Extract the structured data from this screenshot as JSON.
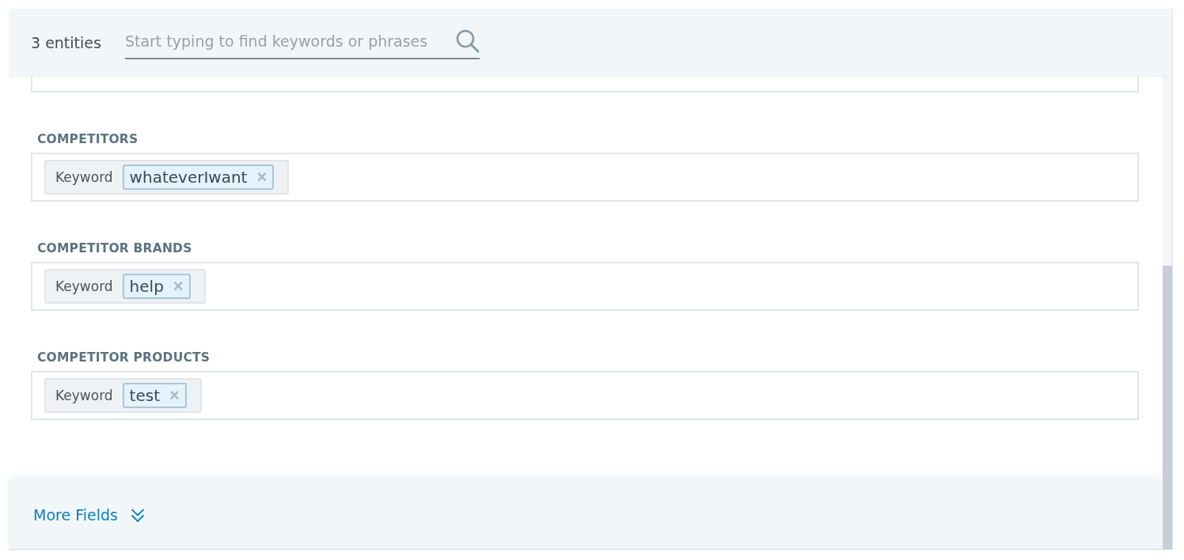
{
  "header": {
    "count": "3 entities",
    "search": {
      "placeholder": "Start typing to find keywords or phrases"
    }
  },
  "fields": [
    {
      "label": "COMPETITORS",
      "tags": [
        {
          "kind": "keyword",
          "type_label": "Keyword",
          "value": "whateverIwant",
          "remove": "×"
        }
      ]
    },
    {
      "label": "COMPETITOR BRANDS",
      "tags": [
        {
          "kind": "keyword",
          "type_label": "Keyword",
          "value": "help",
          "remove": "×"
        }
      ]
    },
    {
      "label": "COMPETITOR PRODUCTS",
      "tags": [
        {
          "kind": "keyword",
          "type_label": "Keyword",
          "value": "test",
          "remove": "×"
        }
      ]
    }
  ],
  "footer": {
    "more_fields": "More Fields",
    "expanded": false
  }
}
